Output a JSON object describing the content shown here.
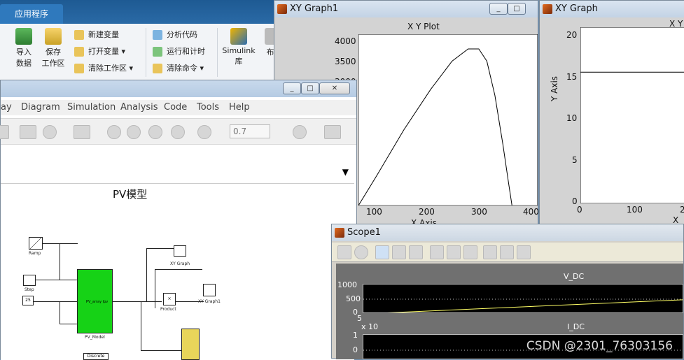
{
  "ribbon": {
    "tab_label": "应用程序",
    "import_label": "导入\n数据",
    "save_ws_label": "保存\n工作区",
    "new_var_label": "新建变量",
    "open_var_label": "打开变量",
    "clear_ws_label": "清除工作区",
    "analyze_code_label": "分析代码",
    "run_time_label": "运行和计时",
    "clear_cmd_label": "清除命令",
    "simulink_label": "Simulink\n库",
    "partial_label": "布"
  },
  "simulink": {
    "window_buttons": [
      "_",
      "□",
      "✕"
    ],
    "menu": [
      "ay",
      "Diagram",
      "Simulation",
      "Analysis",
      "Code",
      "Tools",
      "Help"
    ],
    "stop_time": "0.7",
    "model_title": "PV模型",
    "blocks": {
      "ramp": "Ramp",
      "step": "Step",
      "const": "25",
      "const_label": "",
      "pv_model": "PV_Model",
      "pv_inner": "PV_array  Ipv",
      "xy_graph": "XY Graph",
      "product": "Product",
      "product_sym": "×",
      "xy_graph1": "XY Graph1",
      "discrete": "Discrete"
    }
  },
  "xygraph1": {
    "title": "XY Graph1",
    "plot_title": "X Y Plot",
    "y_ticks": [
      "4000",
      "3500",
      "3000"
    ],
    "x_ticks": [
      "100",
      "200",
      "300",
      "400"
    ],
    "xlabel": "X Axis"
  },
  "xygraph": {
    "title": "XY Graph",
    "plot_title": "X Y",
    "ylabel": "Y Axis",
    "y_ticks": [
      "20",
      "15",
      "10",
      "5",
      "0"
    ],
    "x_ticks": [
      "0",
      "100",
      "2"
    ],
    "xlabel": "X A"
  },
  "scope": {
    "title": "Scope1",
    "plot1_title": "V_DC",
    "plot1_yticks": [
      "1000",
      "500",
      "0"
    ],
    "plot2_exp": "x 10",
    "plot2_exp_power": "5",
    "plot2_title": "I_DC",
    "plot2_yticks": [
      "1",
      "0"
    ]
  },
  "watermark": "CSDN @2301_76303156",
  "chart_data": [
    {
      "type": "line",
      "title": "X Y Plot",
      "xlabel": "X Axis",
      "ylabel": "",
      "xlim": [
        65,
        400
      ],
      "ylim": [
        2700,
        4100
      ],
      "x": [
        65,
        100,
        150,
        200,
        240,
        270,
        290,
        305,
        320,
        335,
        345,
        352
      ],
      "y": [
        2700,
        2950,
        3320,
        3650,
        3880,
        3980,
        3980,
        3880,
        3600,
        3200,
        2900,
        2700
      ]
    },
    {
      "type": "line",
      "title": "X Y",
      "ylabel": "Y Axis",
      "xlim": [
        0,
        200
      ],
      "ylim": [
        0,
        20
      ],
      "x": [
        0,
        200
      ],
      "y": [
        14.9,
        14.9
      ]
    },
    {
      "type": "line",
      "title": "V_DC",
      "xlim": [
        0,
        1
      ],
      "ylim": [
        0,
        1000
      ],
      "x": [
        0,
        1
      ],
      "y": [
        0,
        480
      ]
    }
  ]
}
